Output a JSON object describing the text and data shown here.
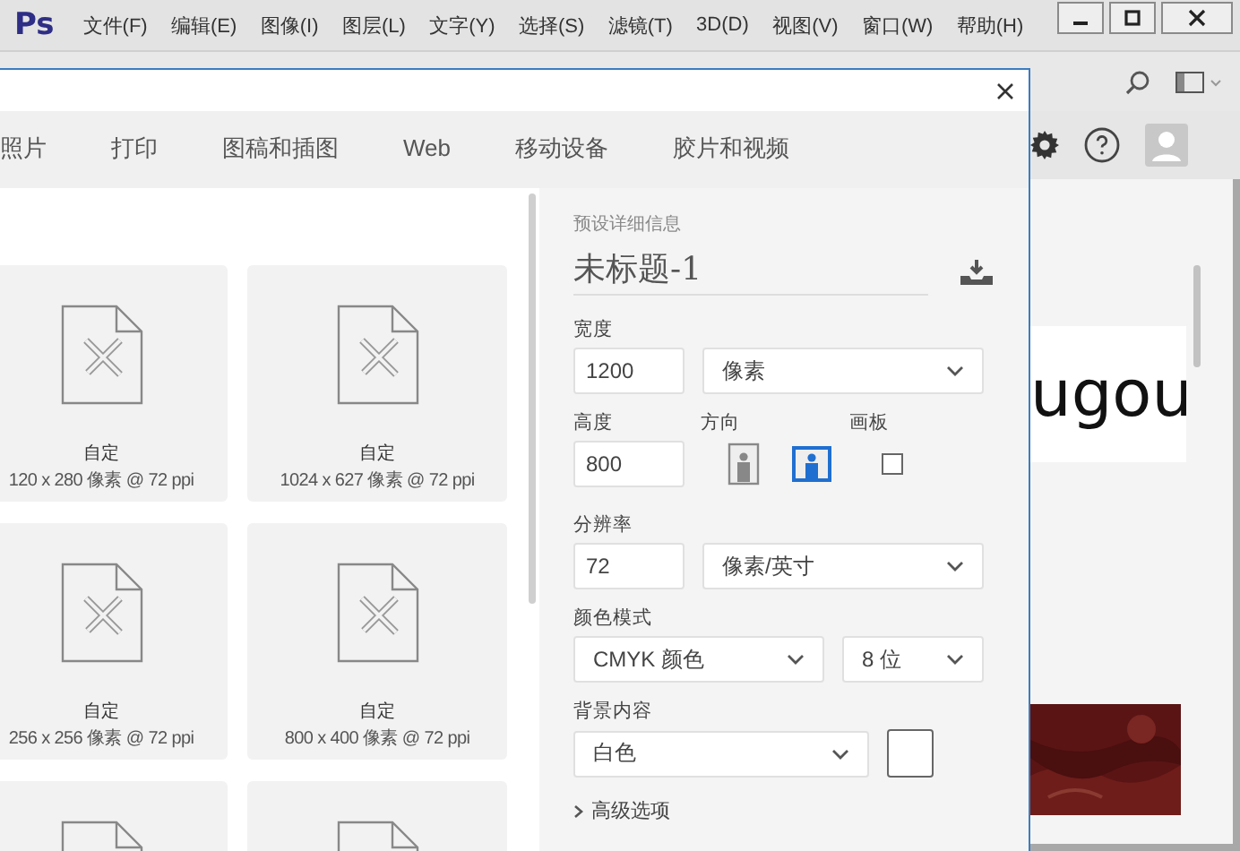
{
  "app": {
    "logo": "Ps",
    "menu": [
      "文件(F)",
      "编辑(E)",
      "图像(I)",
      "图层(L)",
      "文字(Y)",
      "选择(S)",
      "滤镜(T)",
      "3D(D)",
      "视图(V)",
      "窗口(W)",
      "帮助(H)"
    ]
  },
  "dialog": {
    "tabs": [
      {
        "label": "照片",
        "selected": false
      },
      {
        "label": "打印",
        "selected": false
      },
      {
        "label": "图稿和插图",
        "selected": false
      },
      {
        "label": "Web",
        "selected": false
      },
      {
        "label": "移动设备",
        "selected": false
      },
      {
        "label": "胶片和视频",
        "selected": false
      }
    ],
    "presets": [
      {
        "kind": "full",
        "name": "自定",
        "size": "120 x 280 像素 @ 72 ppi"
      },
      {
        "kind": "full",
        "name": "自定",
        "size": "1024 x 627 像素 @ 72 ppi"
      },
      {
        "kind": "full",
        "name": "自定",
        "size": "256 x 256 像素 @ 72 ppi"
      },
      {
        "kind": "full",
        "name": "自定",
        "size": "800 x 400 像素 @ 72 ppi"
      },
      {
        "kind": "cut"
      },
      {
        "kind": "cut"
      }
    ],
    "details": {
      "heading": "预设详细信息",
      "document_name": "未标题-1",
      "width": {
        "label": "宽度",
        "value": "1200",
        "unit": "像素"
      },
      "height": {
        "label": "高度",
        "value": "800"
      },
      "orientation": {
        "label": "方向",
        "options": [
          {
            "kind": "portrait",
            "selected": false
          },
          {
            "kind": "landscape",
            "selected": true
          }
        ]
      },
      "artboard": {
        "label": "画板",
        "checked": false
      },
      "resolution": {
        "label": "分辨率",
        "value": "72",
        "unit": "像素/英寸"
      },
      "color_mode": {
        "label": "颜色模式",
        "mode": "CMYK 颜色",
        "depth": "8 位"
      },
      "background": {
        "label": "背景内容",
        "value": "白色",
        "color": "#ffffff"
      },
      "advanced": {
        "label": "高级选项",
        "expanded": false
      }
    }
  },
  "workspace": {
    "canvas_text": "ugou"
  }
}
